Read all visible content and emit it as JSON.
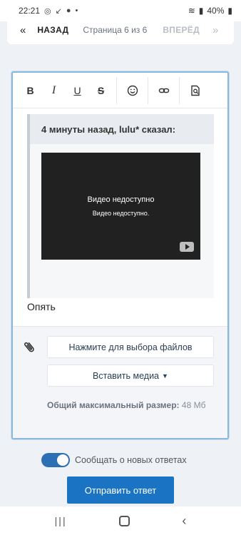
{
  "status": {
    "time": "22:21",
    "battery": "40%"
  },
  "pager": {
    "prev_label": "НАЗАД",
    "page_info": "Страница 6 из 6",
    "next_label": "ВПЕРЁД"
  },
  "editor": {
    "toolbar": {
      "bold": "B",
      "italic": "I",
      "underline": "U",
      "strike": "S"
    },
    "quote": {
      "header": "4 минуты назад, lulu* сказал:",
      "video_title": "Видео недоступно",
      "video_subtitle": "Видео недоступно."
    },
    "reply_text": "Опять"
  },
  "attachments": {
    "pick_files": "Нажмите для выбора файлов",
    "insert_media": "Вставить медиа",
    "max_size_label": "Общий максимальный размер:",
    "max_size_value": "48 Мб"
  },
  "notify_label": "Сообщать о новых ответах",
  "submit_label": "Отправить ответ",
  "colors": {
    "accent": "#1b73c4",
    "toggle": "#2d6fb4",
    "editor_border": "#8cb8da"
  }
}
